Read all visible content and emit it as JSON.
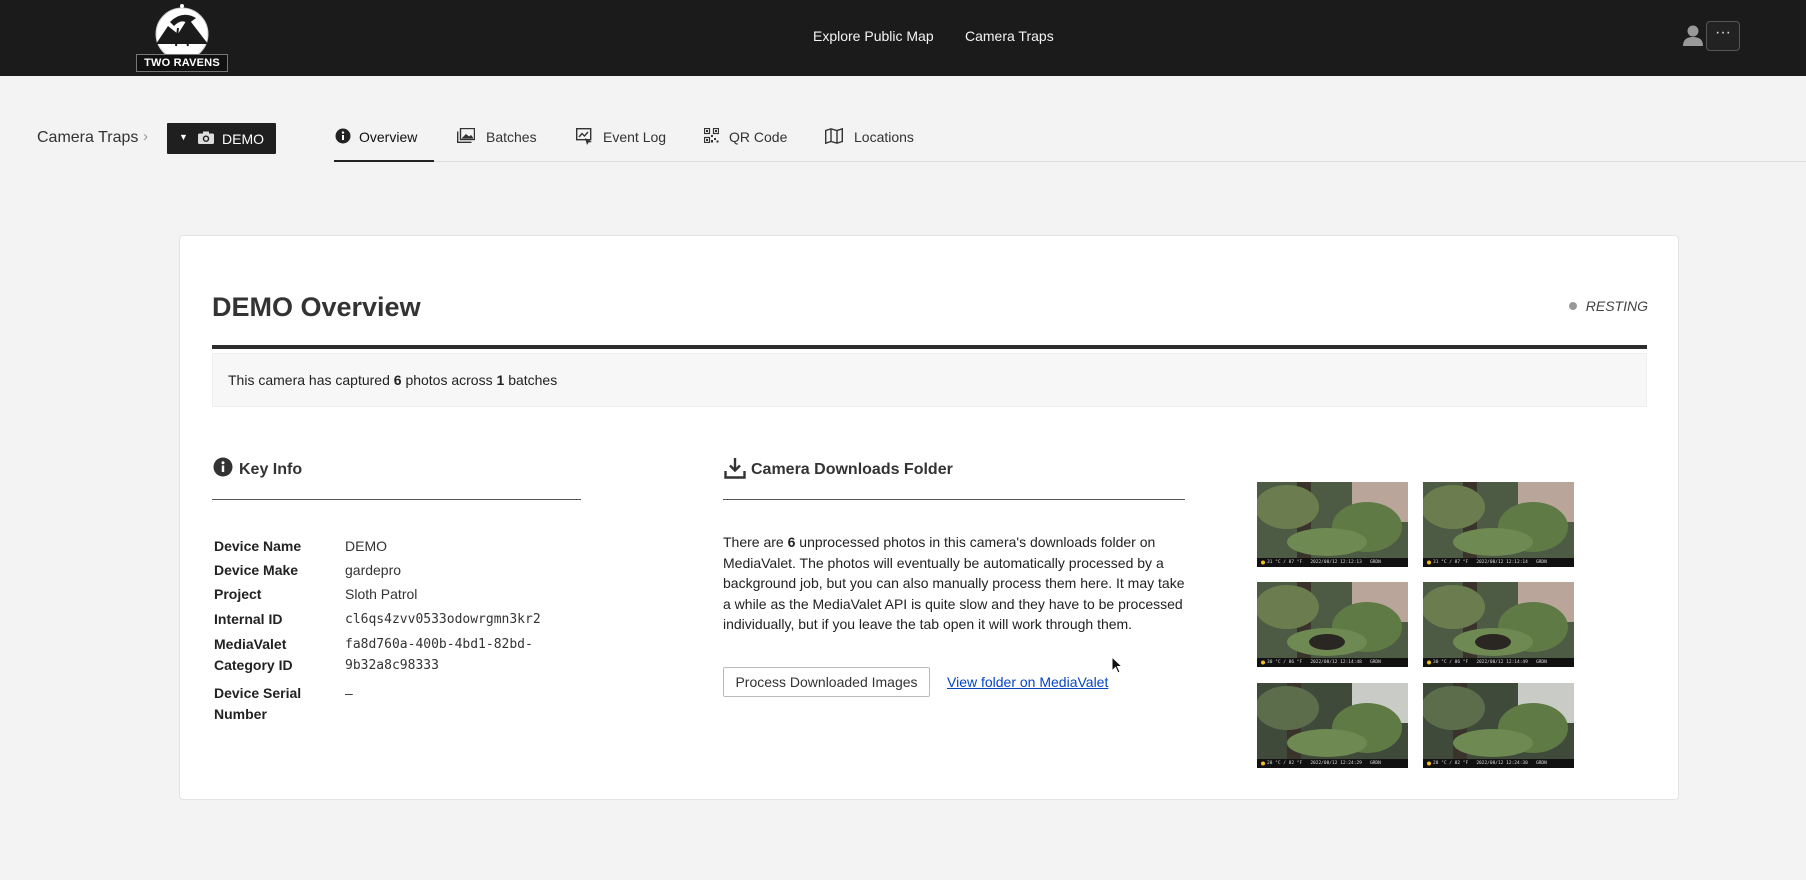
{
  "brand": {
    "name": "TWO RAVENS"
  },
  "topnav": {
    "links": [
      "Explore Public Map",
      "Camera Traps"
    ],
    "more_label": "···"
  },
  "breadcrumb": {
    "root": "Camera Traps",
    "separator": "›",
    "current": "DEMO"
  },
  "tabs": [
    {
      "label": "Overview",
      "icon": "info-icon",
      "active": true
    },
    {
      "label": "Batches",
      "icon": "images-icon",
      "active": false
    },
    {
      "label": "Event Log",
      "icon": "event-log-icon",
      "active": false
    },
    {
      "label": "QR Code",
      "icon": "qr-code-icon",
      "active": false
    },
    {
      "label": "Locations",
      "icon": "map-icon",
      "active": false
    }
  ],
  "overview": {
    "title": "DEMO Overview",
    "status": "RESTING",
    "summary": {
      "prefix": "This camera has captured",
      "photos": "6",
      "middle": "photos across",
      "batches": "1",
      "suffix": "batches"
    }
  },
  "key_info": {
    "title": "Key Info",
    "rows": [
      {
        "label": "Device Name",
        "value": "DEMO"
      },
      {
        "label": "Device Make",
        "value": "gardepro"
      },
      {
        "label": "Project",
        "value": "Sloth Patrol"
      },
      {
        "label": "Internal ID",
        "value": "cl6qs4zvv0533odowrgmn3kr2"
      },
      {
        "label": "MediaValet Category ID",
        "value": "fa8d760a-400b-4bd1-82bd-9b32a8c98333"
      },
      {
        "label": "Device Serial Number",
        "value": "–"
      }
    ]
  },
  "downloads": {
    "title": "Camera Downloads Folder",
    "text_prefix": "There are",
    "count": "6",
    "text_suffix": "unprocessed photos in this camera's downloads folder on MediaValet. The photos will eventually be automatically processed by a background job, but you can also manually process them here. It may take a while as the MediaValet API is quite slow and they have to be processed individually, but if you leave the tab open it will work through them.",
    "process_button": "Process Downloaded Images",
    "view_link": "View folder on MediaValet"
  },
  "thumbnails": [
    {
      "caption": "31 °C / 87 °F   2022/08/12 12:12:13   GRDN"
    },
    {
      "caption": "31 °C / 87 °F   2022/08/12 12:12:14   GRDN"
    },
    {
      "caption": "30 °C / 86 °F   2022/08/12 12:14:48   GRDN"
    },
    {
      "caption": "30 °C / 86 °F   2022/08/12 12:14:49   GRDN"
    },
    {
      "caption": "28 °C / 82 °F   2022/08/12 12:24:29   GRDN"
    },
    {
      "caption": "28 °C / 82 °F   2022/08/12 12:24:30   GRDN"
    }
  ],
  "colors": {
    "topnav_bg": "#1b1b1b",
    "link": "#0645c2",
    "page_bg": "#f3f3f3"
  }
}
